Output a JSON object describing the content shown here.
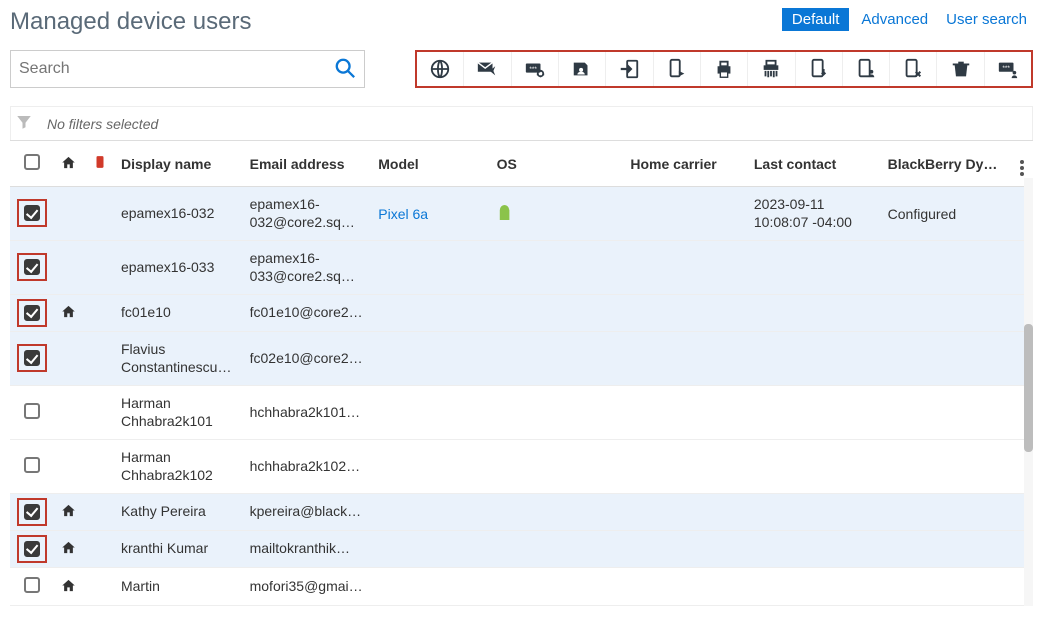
{
  "header": {
    "title": "Managed device users",
    "tabs": {
      "default": "Default",
      "advanced": "Advanced",
      "user_search": "User search"
    }
  },
  "search": {
    "placeholder": "Search"
  },
  "toolbar": [
    {
      "name": "globe-icon"
    },
    {
      "name": "send-email-icon"
    },
    {
      "name": "set-password-icon"
    },
    {
      "name": "assign-group-icon"
    },
    {
      "name": "export-icon"
    },
    {
      "name": "device-action-icon"
    },
    {
      "name": "print-icon"
    },
    {
      "name": "shred-icon"
    },
    {
      "name": "device-download-icon"
    },
    {
      "name": "device-user-icon"
    },
    {
      "name": "device-remove-icon"
    },
    {
      "name": "trash-icon"
    },
    {
      "name": "password-user-icon"
    }
  ],
  "filters": {
    "text": "No filters selected"
  },
  "columns": {
    "display_name": "Display name",
    "email": "Email address",
    "model": "Model",
    "os": "OS",
    "carrier": "Home carrier",
    "last": "Last contact",
    "bb": "BlackBerry Dyn…"
  },
  "rows": [
    {
      "checked": true,
      "hl": true,
      "home": false,
      "name": "epamex16-032",
      "email": "epamex16-032@core2.sq…",
      "model": "Pixel 6a",
      "os": "android",
      "last": "2023-09-11 10:08:07 -04:00",
      "bb": "Configured"
    },
    {
      "checked": true,
      "hl": true,
      "home": false,
      "name": "epamex16-033",
      "email": "epamex16-033@core2.sq…"
    },
    {
      "checked": true,
      "hl": true,
      "home": true,
      "name": "fc01e10",
      "email": "fc01e10@core2…"
    },
    {
      "checked": true,
      "hl": true,
      "home": false,
      "name": "Flavius Constantinescu…",
      "email": "fc02e10@core2…"
    },
    {
      "checked": false,
      "hl": false,
      "home": false,
      "name": "Harman Chhabra2k101",
      "email": "hchhabra2k101…"
    },
    {
      "checked": false,
      "hl": false,
      "home": false,
      "name": "Harman Chhabra2k102",
      "email": "hchhabra2k102…"
    },
    {
      "checked": true,
      "hl": true,
      "home": true,
      "name": "Kathy Pereira",
      "email": "kpereira@black…"
    },
    {
      "checked": true,
      "hl": true,
      "home": true,
      "name": "kranthi Kumar",
      "email": "mailtokranthik…"
    },
    {
      "checked": false,
      "hl": false,
      "home": true,
      "name": "Martin",
      "email": "mofori35@gmai…"
    }
  ]
}
